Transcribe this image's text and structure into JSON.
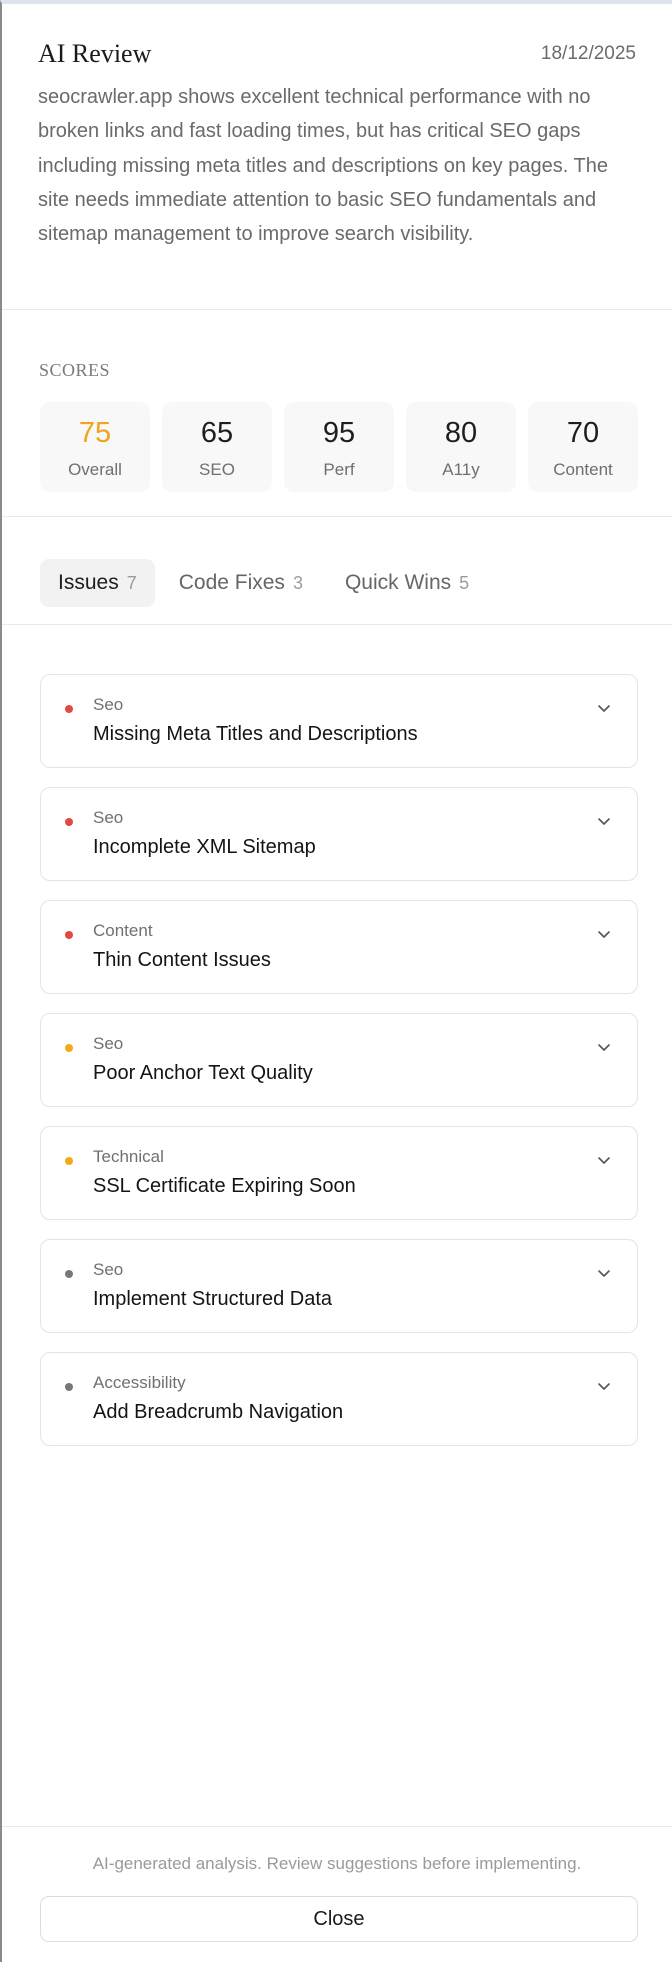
{
  "header": {
    "title": "AI Review",
    "date": "18/12/2025"
  },
  "summary": "seocrawler.app shows excellent technical performance with no broken links and fast loading times, but has critical SEO gaps including missing meta titles and descriptions on key pages. The site needs immediate attention to basic SEO fundamentals and sitemap management to improve search visibility.",
  "scores": {
    "heading": "SCORES",
    "items": [
      {
        "value": "75",
        "label": "Overall"
      },
      {
        "value": "65",
        "label": "SEO"
      },
      {
        "value": "95",
        "label": "Perf"
      },
      {
        "value": "80",
        "label": "A11y"
      },
      {
        "value": "70",
        "label": "Content"
      }
    ],
    "accent_color": "#f1a31b"
  },
  "tabs": [
    {
      "label": "Issues",
      "count": "7",
      "active": true
    },
    {
      "label": "Code Fixes",
      "count": "3",
      "active": false
    },
    {
      "label": "Quick Wins",
      "count": "5",
      "active": false
    }
  ],
  "severity_colors": {
    "high": "#e5483f",
    "medium": "#f2ab17",
    "low": "#777777"
  },
  "issues": [
    {
      "category": "Seo",
      "title": "Missing Meta Titles and Descriptions",
      "severity": "high"
    },
    {
      "category": "Seo",
      "title": "Incomplete XML Sitemap",
      "severity": "high"
    },
    {
      "category": "Content",
      "title": "Thin Content Issues",
      "severity": "high"
    },
    {
      "category": "Seo",
      "title": "Poor Anchor Text Quality",
      "severity": "medium"
    },
    {
      "category": "Technical",
      "title": "SSL Certificate Expiring Soon",
      "severity": "medium"
    },
    {
      "category": "Seo",
      "title": "Implement Structured Data",
      "severity": "low"
    },
    {
      "category": "Accessibility",
      "title": "Add Breadcrumb Navigation",
      "severity": "low"
    }
  ],
  "icons": {
    "issue_expand": "chevron-down-icon",
    "severity": "severity-dot-icon"
  },
  "footer": {
    "note": "AI-generated analysis. Review suggestions before implementing.",
    "close_label": "Close"
  }
}
